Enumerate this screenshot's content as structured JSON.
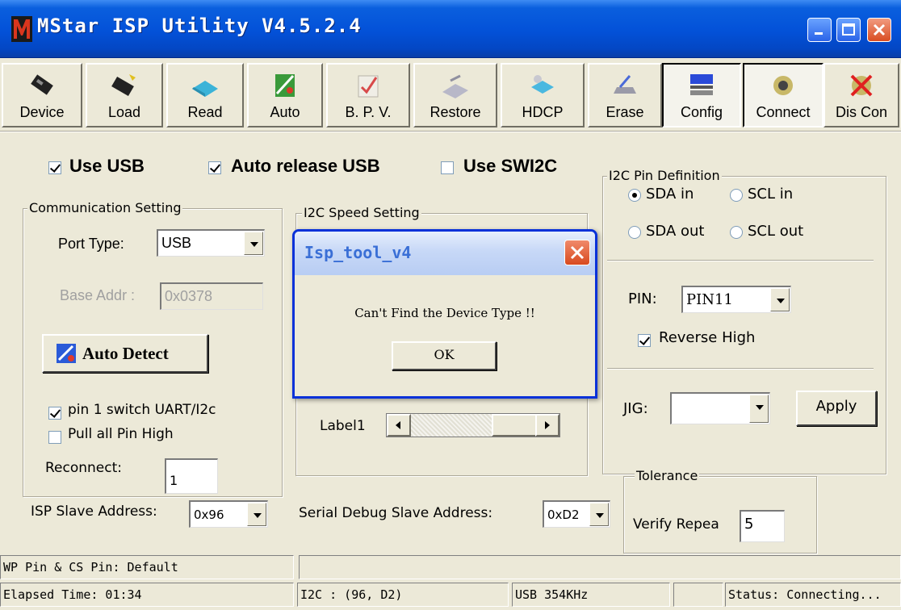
{
  "window": {
    "title": "MStar ISP Utility V4.5.2.4"
  },
  "toolbar": {
    "buttons": [
      {
        "label": "Device",
        "icon": "device-chip-icon"
      },
      {
        "label": "Load",
        "icon": "load-chip-icon"
      },
      {
        "label": "Read",
        "icon": "read-icon"
      },
      {
        "label": "Auto",
        "icon": "auto-icon"
      },
      {
        "label": "B. P. V.",
        "icon": "bpv-check-icon"
      },
      {
        "label": "Restore",
        "icon": "restore-icon"
      },
      {
        "label": "HDCP",
        "icon": "hdcp-icon"
      },
      {
        "label": "Erase",
        "icon": "erase-icon"
      },
      {
        "label": "Config",
        "icon": "config-icon"
      },
      {
        "label": "Connect",
        "icon": "connect-icon"
      },
      {
        "label": "Dis Con",
        "icon": "disconnect-icon"
      }
    ]
  },
  "options": {
    "use_usb": {
      "label": "Use USB",
      "checked": true
    },
    "auto_release_usb": {
      "label": "Auto release USB",
      "checked": true
    },
    "use_swi2c": {
      "label": "Use SWI2C",
      "checked": false
    }
  },
  "communication": {
    "legend": "Communication Setting",
    "port_type_label": "Port Type:",
    "port_type_value": "USB",
    "base_addr_label": "Base Addr :",
    "base_addr_value": "0x0378",
    "auto_detect_label": "Auto Detect",
    "pin1_switch": {
      "label": "pin 1 switch UART/I2c",
      "checked": true
    },
    "pull_all_pin_high": {
      "label": "Pull all Pin High",
      "checked": false
    },
    "reconnect_label": "Reconnect:",
    "reconnect_value": "1"
  },
  "i2c_speed": {
    "legend": "I2C Speed Setting",
    "label1": "Label1"
  },
  "i2c_pin": {
    "legend": "I2C Pin Definition",
    "sda_in": "SDA in",
    "scl_in": "SCL in",
    "sda_out": "SDA out",
    "scl_out": "SCL out",
    "pin_label": "PIN:",
    "pin_value": "PIN11",
    "reverse_high": {
      "label": "Reverse High",
      "checked": true
    },
    "jig_label": "JIG:",
    "jig_value": "",
    "apply_label": "Apply"
  },
  "tolerance": {
    "legend": "Tolerance",
    "verify_label": "Verify Repea",
    "verify_value": "5"
  },
  "addresses": {
    "isp_slave_label": "ISP Slave Address:",
    "isp_slave_value": "0x96",
    "serial_debug_label": "Serial Debug Slave Address:",
    "serial_debug_value": "0xD2"
  },
  "dialog": {
    "title": "Isp_tool_v4",
    "message": "Can't Find the Device Type !!",
    "ok_label": "OK"
  },
  "status": {
    "wp_pin": "WP Pin & CS Pin: Default",
    "wp_right": "",
    "elapsed": "Elapsed Time: 01:34",
    "i2c": "I2C : (96, D2)",
    "usb": "USB  354KHz",
    "blank": "",
    "state": "Status: Connecting..."
  },
  "colors": {
    "titlebar": "#0351d8",
    "window_bg": "#ece9d8",
    "dialog_border": "#0831d9",
    "close_red": "#d94d22"
  }
}
